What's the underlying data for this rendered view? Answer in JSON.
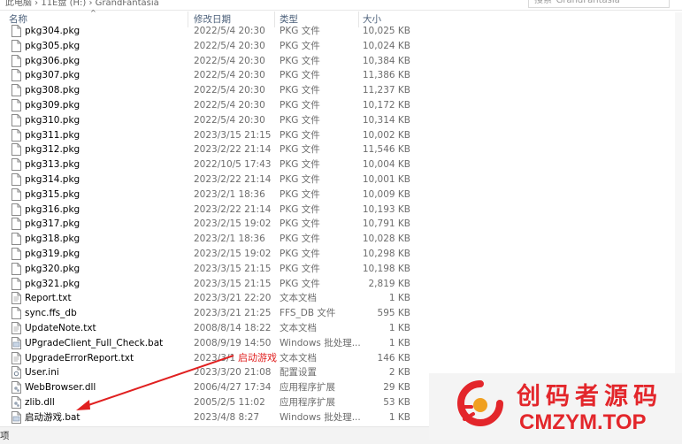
{
  "breadcrumb": "此电脑 › 11E盘 (H:) › GrandFantasia",
  "search_placeholder": "搜索\"GrandFantasia\"",
  "columns": {
    "name": "名称",
    "date": "修改日期",
    "type": "类型",
    "size": "大小"
  },
  "files": [
    {
      "name": "pkg304.pkg",
      "date": "2022/5/4 20:30",
      "type": "PKG 文件",
      "size": "10,025 KB",
      "icon": "file-icon"
    },
    {
      "name": "pkg305.pkg",
      "date": "2022/5/4 20:30",
      "type": "PKG 文件",
      "size": "10,024 KB",
      "icon": "file-icon"
    },
    {
      "name": "pkg306.pkg",
      "date": "2022/5/4 20:30",
      "type": "PKG 文件",
      "size": "10,384 KB",
      "icon": "file-icon"
    },
    {
      "name": "pkg307.pkg",
      "date": "2022/5/4 20:30",
      "type": "PKG 文件",
      "size": "11,386 KB",
      "icon": "file-icon"
    },
    {
      "name": "pkg308.pkg",
      "date": "2022/5/4 20:30",
      "type": "PKG 文件",
      "size": "11,237 KB",
      "icon": "file-icon"
    },
    {
      "name": "pkg309.pkg",
      "date": "2022/5/4 20:30",
      "type": "PKG 文件",
      "size": "10,172 KB",
      "icon": "file-icon"
    },
    {
      "name": "pkg310.pkg",
      "date": "2022/5/4 20:30",
      "type": "PKG 文件",
      "size": "10,314 KB",
      "icon": "file-icon"
    },
    {
      "name": "pkg311.pkg",
      "date": "2023/3/15 21:15",
      "type": "PKG 文件",
      "size": "10,002 KB",
      "icon": "file-icon"
    },
    {
      "name": "pkg312.pkg",
      "date": "2023/2/22 21:14",
      "type": "PKG 文件",
      "size": "11,546 KB",
      "icon": "file-icon"
    },
    {
      "name": "pkg313.pkg",
      "date": "2022/10/5 17:43",
      "type": "PKG 文件",
      "size": "10,004 KB",
      "icon": "file-icon"
    },
    {
      "name": "pkg314.pkg",
      "date": "2023/2/22 21:14",
      "type": "PKG 文件",
      "size": "10,001 KB",
      "icon": "file-icon"
    },
    {
      "name": "pkg315.pkg",
      "date": "2023/2/1 18:36",
      "type": "PKG 文件",
      "size": "10,009 KB",
      "icon": "file-icon"
    },
    {
      "name": "pkg316.pkg",
      "date": "2023/2/22 21:14",
      "type": "PKG 文件",
      "size": "10,193 KB",
      "icon": "file-icon"
    },
    {
      "name": "pkg317.pkg",
      "date": "2023/2/15 19:02",
      "type": "PKG 文件",
      "size": "10,791 KB",
      "icon": "file-icon"
    },
    {
      "name": "pkg318.pkg",
      "date": "2023/2/1 18:36",
      "type": "PKG 文件",
      "size": "10,028 KB",
      "icon": "file-icon"
    },
    {
      "name": "pkg319.pkg",
      "date": "2023/2/15 19:02",
      "type": "PKG 文件",
      "size": "10,298 KB",
      "icon": "file-icon"
    },
    {
      "name": "pkg320.pkg",
      "date": "2023/3/15 21:15",
      "type": "PKG 文件",
      "size": "10,198 KB",
      "icon": "file-icon"
    },
    {
      "name": "pkg321.pkg",
      "date": "2023/3/15 21:15",
      "type": "PKG 文件",
      "size": "2,819 KB",
      "icon": "file-icon"
    },
    {
      "name": "Report.txt",
      "date": "2023/3/21 22:20",
      "type": "文本文档",
      "size": "1 KB",
      "icon": "text-file-icon"
    },
    {
      "name": "sync.ffs_db",
      "date": "2023/3/21 21:25",
      "type": "FFS_DB 文件",
      "size": "595 KB",
      "icon": "file-icon"
    },
    {
      "name": "UpdateNote.txt",
      "date": "2008/8/14 18:22",
      "type": "文本文档",
      "size": "1 KB",
      "icon": "text-file-icon"
    },
    {
      "name": "UPgradeClient_Full_Check.bat",
      "date": "2008/9/19 14:50",
      "type": "Windows 批处理...",
      "size": "1 KB",
      "icon": "batch-file-icon"
    },
    {
      "name": "UpgradeErrorReport.txt",
      "date": "2023/3/1",
      "type": "文本文档",
      "size": "146 KB",
      "icon": "text-file-icon"
    },
    {
      "name": "User.ini",
      "date": "2023/3/20 21:08",
      "type": "配置设置",
      "size": "2 KB",
      "icon": "settings-file-icon"
    },
    {
      "name": "WebBrowser.dll",
      "date": "2006/4/27 17:34",
      "type": "应用程序扩展",
      "size": "29 KB",
      "icon": "dll-file-icon"
    },
    {
      "name": "zlib.dll",
      "date": "2005/2/5 11:02",
      "type": "应用程序扩展",
      "size": "53 KB",
      "icon": "dll-file-icon"
    },
    {
      "name": "启动游戏.bat",
      "date": "2023/4/8 8:27",
      "type": "Windows 批处理...",
      "size": "1 KB",
      "icon": "batch-file-icon"
    }
  ],
  "status_bar": "项",
  "annotation": "启动游戏",
  "watermark": {
    "chinese": "创码者源码",
    "english": "CMZYM.TOP"
  },
  "colors": {
    "annotation": "#e02020",
    "watermark": "#e3262b",
    "header_text": "#4c607a"
  }
}
